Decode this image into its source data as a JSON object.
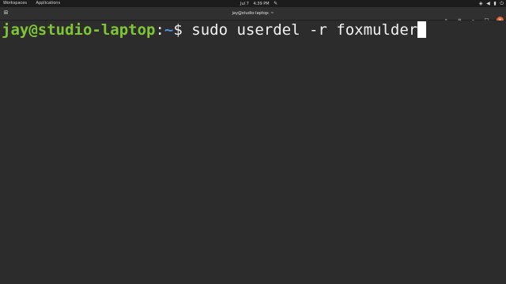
{
  "topbar": {
    "workspaces": "Workspaces",
    "applications": "Applications",
    "date": "Jul 7",
    "time": "4:39 PM",
    "icons": [
      "notification-icon",
      "network-icon",
      "volume-icon",
      "battery-icon",
      "power-icon"
    ]
  },
  "titlebar": {
    "title": "jay@studio-laptop: ~"
  },
  "terminal": {
    "user_host": "jay@studio-laptop",
    "colon": ":",
    "path": "~",
    "prompt_symbol": "$",
    "command": " sudo userdel -r foxmulder"
  },
  "colors": {
    "prompt_user": "#7ec634",
    "prompt_path": "#4e8fd8",
    "background": "#2c2c2c",
    "close_button": "#e0653a"
  }
}
